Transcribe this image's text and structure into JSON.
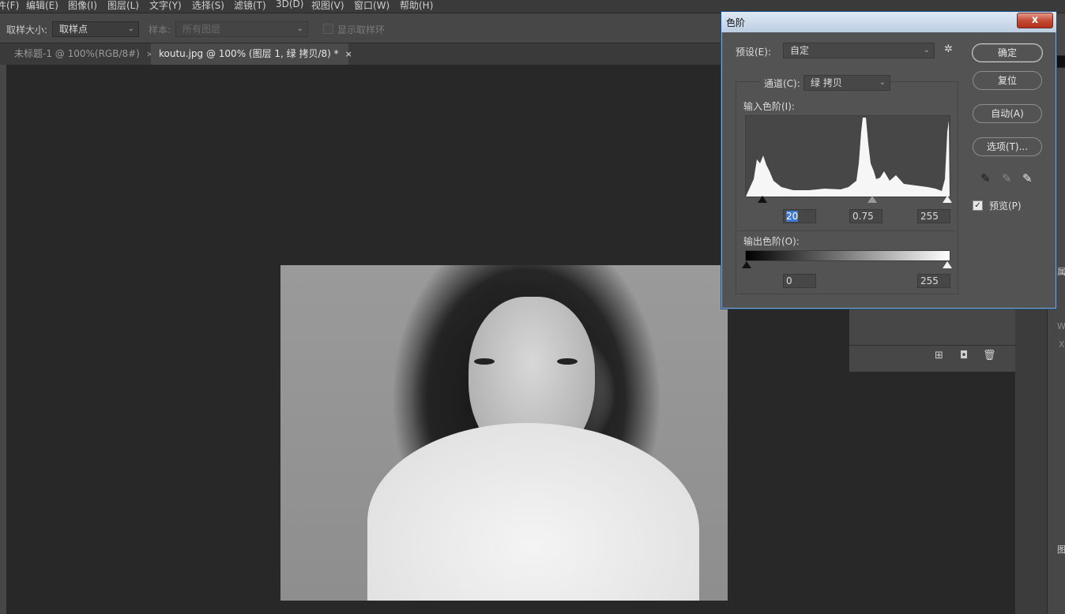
{
  "menubar": [
    "件(F)",
    "编辑(E)",
    "图像(I)",
    "图层(L)",
    "文字(Y)",
    "选择(S)",
    "滤镜(T)",
    "3D(D)",
    "视图(V)",
    "窗口(W)",
    "帮助(H)"
  ],
  "options": {
    "sample_size_label": "取样大小:",
    "sample_size_value": "取样点",
    "sample_label": "样本:",
    "sample_value": "所有图层",
    "show_ring_label": "显示取样环"
  },
  "tabs": [
    {
      "label": "未标题-1 @ 100%(RGB/8#)",
      "close": "×",
      "active": false
    },
    {
      "label": "koutu.jpg @ 100% (图层 1, 绿 拷贝/8) *",
      "close": "×",
      "active": true
    }
  ],
  "dialog": {
    "title": "色阶",
    "close": "x",
    "preset_label": "预设(E):",
    "preset_value": "自定",
    "channel_label": "通道(C):",
    "channel_value": "绿 拷贝",
    "input_levels_label": "输入色阶(I):",
    "input_black": "20",
    "input_gamma": "0.75",
    "input_white": "255",
    "output_levels_label": "输出色阶(O):",
    "output_black": "0",
    "output_white": "255",
    "buttons": {
      "ok": "确定",
      "reset": "复位",
      "auto": "自动(A)",
      "options": "选项(T)..."
    },
    "preview_label": "预览(P)",
    "preview_checked": true
  },
  "side": {
    "panel_letter_1": "属",
    "panel_letter_2": "图",
    "panel_letter_w": "W",
    "panel_letter_x": "X"
  },
  "colors": {
    "accent": "#3a79d6",
    "dialog_bg": "#535353",
    "app_bg": "#282828"
  }
}
